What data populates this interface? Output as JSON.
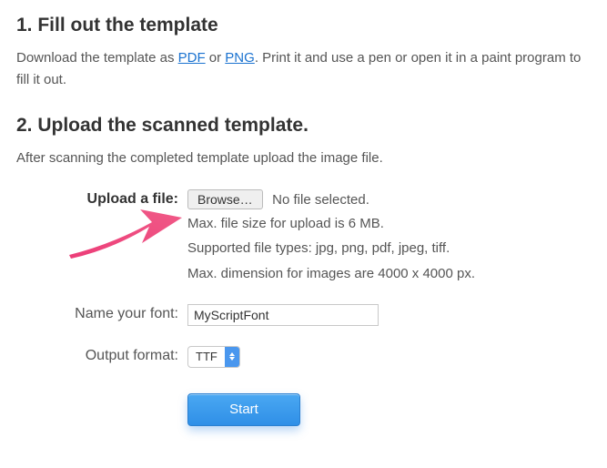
{
  "step1": {
    "heading": "1. Fill out the template",
    "intro_pre": "Download the template as ",
    "link_pdf": "PDF",
    "intro_or": " or ",
    "link_png": "PNG",
    "intro_post": ". Print it and use a pen or open it in a paint program to fill it out."
  },
  "step2": {
    "heading": "2. Upload the scanned template.",
    "intro": "After scanning the completed template upload the image file."
  },
  "form": {
    "upload_label": "Upload a file:",
    "browse_button": "Browse…",
    "no_file_text": "No file selected.",
    "hint_size": "Max. file size for upload is 6 MB.",
    "hint_types": "Supported file types: jpg, png, pdf, jpeg, tiff.",
    "hint_dim": "Max. dimension for images are 4000 x 4000 px.",
    "name_label": "Name your font:",
    "name_value": "MyScriptFont",
    "output_label": "Output format:",
    "output_value": "TTF",
    "start_button": "Start"
  }
}
